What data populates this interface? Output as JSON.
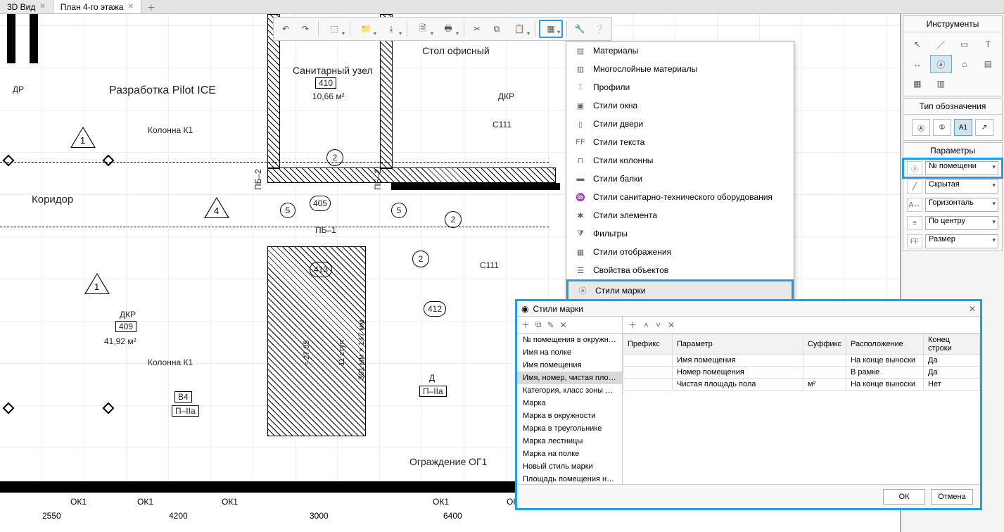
{
  "tabs": {
    "view3d": "3D Вид",
    "plan": "План 4-го этажа"
  },
  "plan": {
    "razrabotka": "Разработка Pilot ICE",
    "kolonna": "Колонна К1",
    "koridor": "Коридор",
    "sanuzel": "Санитарный узел",
    "sanuzel_num": "410",
    "sanuzel_area": "10,66 м²",
    "stol": "Стол офисный",
    "dkr": "ДКР",
    "dr": "ДР",
    "c111": "С111",
    "pb2_v1": "ПБ–2",
    "pb2_v2": "ПБ–2",
    "pb1": "ПБ–1",
    "n405": "405",
    "n413": "413",
    "n412": "412",
    "n5a": "5",
    "n5b": "5",
    "n2a": "2",
    "n2b": "2",
    "n2c": "2",
    "dkr2": "ДКР",
    "dkr2_num": "409",
    "dkr2_area": "41,92 м²",
    "kolonna2": "Колонна К1",
    "b4": "В4",
    "p2a": "П–IIа",
    "d": "Д",
    "p2a_2": "П–IIа",
    "stair_h": "≈ 27,05",
    "stair_n": "11 ступ",
    "stair_w": "301 мм × 147 мм",
    "ograzh": "Ограждение ОГ1",
    "ok1": "ОК1",
    "d2550": "2550",
    "d4200": "4200",
    "d3000": "3000",
    "d6400": "6400",
    "tri1": "1",
    "tri4": "4",
    "tri1b": "1"
  },
  "menu": {
    "materials": "Материалы",
    "multilayer": "Многослойные материалы",
    "profiles": "Профили",
    "window_styles": "Стили окна",
    "door_styles": "Стили двери",
    "text_styles": "Стили текста",
    "column_styles": "Стили колонны",
    "beam_styles": "Стили балки",
    "plumbing_styles": "Стили санитарно-технического оборудования",
    "element_styles": "Стили элемента",
    "filters": "Фильтры",
    "display_styles": "Стили отображения",
    "object_props": "Свойства объектов",
    "mark_styles": "Стили марки"
  },
  "right": {
    "tools_title": "Инструменты",
    "type_title": "Тип обозначения",
    "params_title": "Параметры",
    "p1": "№ помещени",
    "p2": "Скрытая",
    "p3": "Горизонталь",
    "p4": "По центру",
    "p5": "Размер"
  },
  "dialog": {
    "title": "Стили марки",
    "list": [
      "№ помещения в окружности",
      "Имя на полке",
      "Имя помещения",
      "Имя, номер, чистая площадь по",
      "Категория, класс зоны помещен",
      "Марка",
      "Марка в окружности",
      "Марка в треугольнике",
      "Марка лестницы",
      "Марка на полке",
      "Новый стиль марки",
      "Площадь помещения на полке"
    ],
    "selected_index": 3,
    "cols": {
      "prefix": "Префикс",
      "param": "Параметр",
      "suffix": "Суффикс",
      "pos": "Расположение",
      "eol": "Конец строки"
    },
    "rows": [
      {
        "prefix": "",
        "param": "Имя помещения",
        "suffix": "",
        "pos": "На конце выноски",
        "eol": "Да"
      },
      {
        "prefix": "",
        "param": "Номер помещения",
        "suffix": "",
        "pos": "В рамке",
        "eol": "Да"
      },
      {
        "prefix": "",
        "param": "Чистая площадь пола",
        "suffix": "м²",
        "pos": "На конце выноски",
        "eol": "Нет"
      }
    ],
    "ok": "ОК",
    "cancel": "Отмена"
  }
}
